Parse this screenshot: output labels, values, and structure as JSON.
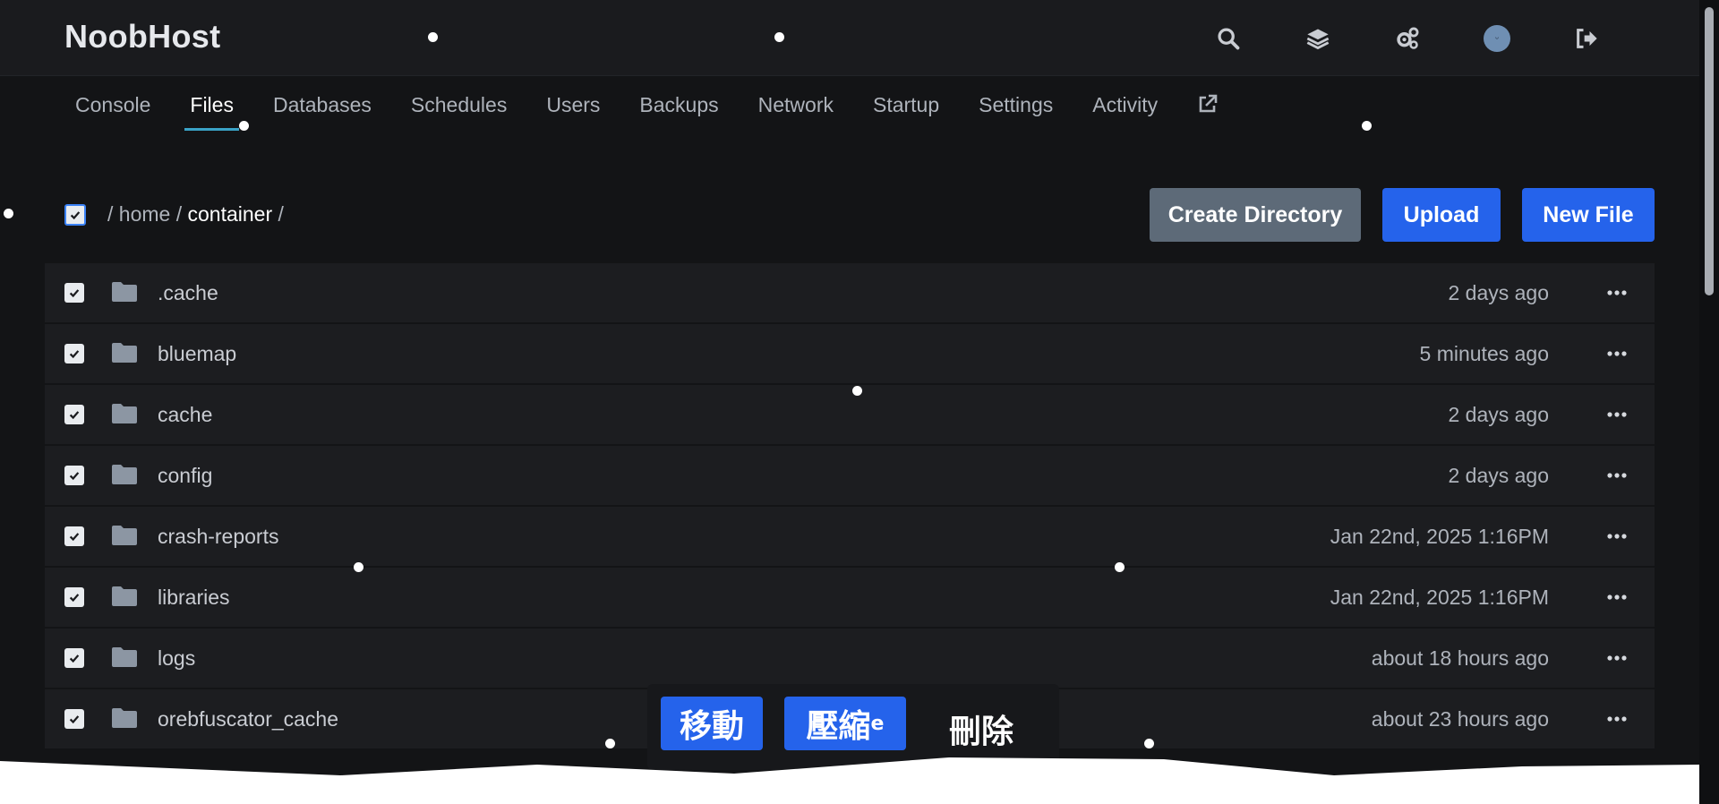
{
  "header": {
    "brand": "NoobHost",
    "icons": [
      "search-icon",
      "layers-icon",
      "cogs-icon",
      "avatar",
      "sign-out-icon"
    ]
  },
  "tabs": [
    {
      "label": "Console"
    },
    {
      "label": "Files"
    },
    {
      "label": "Databases"
    },
    {
      "label": "Schedules"
    },
    {
      "label": "Users"
    },
    {
      "label": "Backups"
    },
    {
      "label": "Network"
    },
    {
      "label": "Startup"
    },
    {
      "label": "Settings"
    },
    {
      "label": "Activity"
    }
  ],
  "active_tab": "Files",
  "breadcrumb": {
    "sep": "/",
    "parts": [
      "home",
      "container"
    ]
  },
  "buttons": {
    "create_directory": "Create Directory",
    "upload": "Upload",
    "new_file": "New File"
  },
  "files": [
    {
      "name": ".cache",
      "modified": "2 days ago"
    },
    {
      "name": "bluemap",
      "modified": "5 minutes ago"
    },
    {
      "name": "cache",
      "modified": "2 days ago"
    },
    {
      "name": "config",
      "modified": "2 days ago"
    },
    {
      "name": "crash-reports",
      "modified": "Jan 22nd, 2025 1:16PM"
    },
    {
      "name": "libraries",
      "modified": "Jan 22nd, 2025 1:16PM"
    },
    {
      "name": "logs",
      "modified": "about 18 hours ago"
    },
    {
      "name": "orebfuscator_cache",
      "modified": "about 23 hours ago"
    }
  ],
  "mass_actions": {
    "move": "移動",
    "archive": "壓縮",
    "archive_suffix": "e",
    "delete": "刪除"
  },
  "colors": {
    "accent_blue": "#2563eb",
    "tab_underline": "#3aa3c7",
    "gray_button": "#5d6a78"
  }
}
